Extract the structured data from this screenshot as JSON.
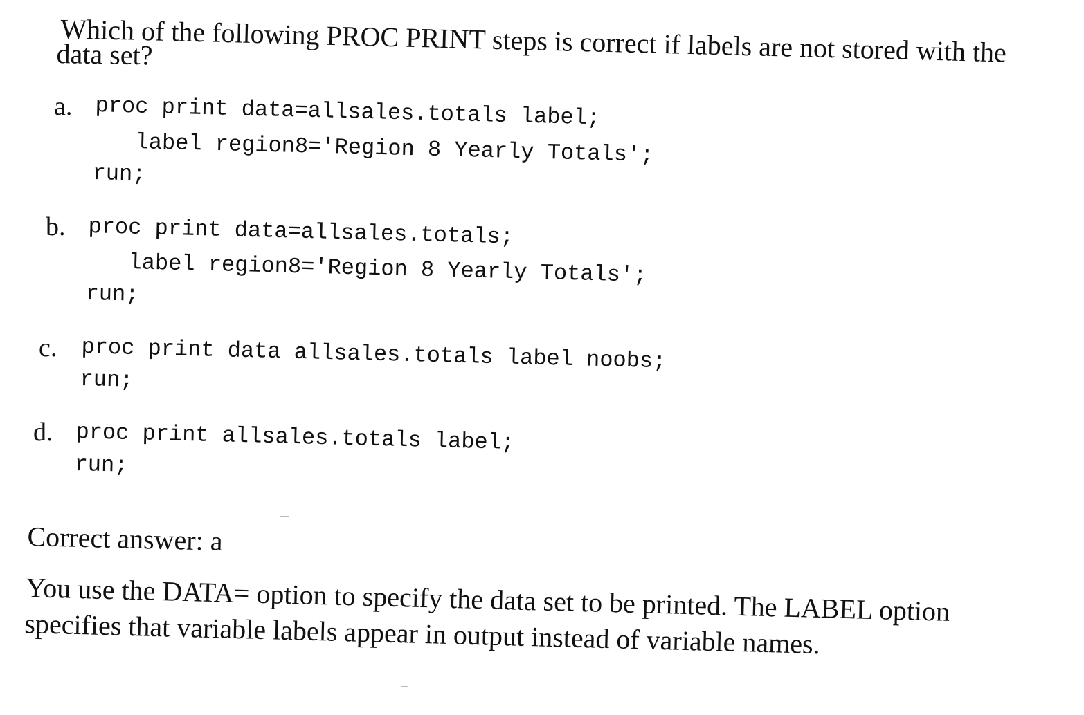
{
  "question": {
    "line1": "Which of the following PROC PRINT steps is correct if labels are not stored with the",
    "line2": "data set?"
  },
  "options": [
    {
      "letter": "a.",
      "lines": [
        "proc print data=allsales.totals label;",
        "label region8='Region 8 Yearly Totals';",
        "run;"
      ]
    },
    {
      "letter": "b.",
      "lines": [
        "proc print data=allsales.totals;",
        "label region8='Region 8 Yearly Totals';",
        "run;"
      ]
    },
    {
      "letter": "c.",
      "lines": [
        "proc print data allsales.totals label noobs;",
        "run;"
      ]
    },
    {
      "letter": "d.",
      "lines": [
        "proc print allsales.totals label;",
        "run;"
      ]
    }
  ],
  "answer": {
    "text": "Correct answer: a"
  },
  "explanation": {
    "line1": "You use the DATA= option to specify the data set to be printed. The LABEL option",
    "line2": "specifies that variable labels appear in output instead of variable names."
  }
}
